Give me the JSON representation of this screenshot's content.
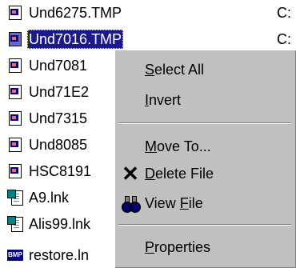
{
  "files": [
    {
      "name": "Und6275.TMP",
      "icon": "tmp-file-icon",
      "path": "C:"
    },
    {
      "name": "Und7016.TMP",
      "icon": "tmp-file-icon",
      "path": "C:",
      "selected": true
    },
    {
      "name": "Und7081",
      "icon": "tmp-file-icon",
      "path": ""
    },
    {
      "name": "Und71E2",
      "icon": "tmp-file-icon",
      "path": ""
    },
    {
      "name": "Und7315",
      "icon": "tmp-file-icon",
      "path": ""
    },
    {
      "name": "Und8085",
      "icon": "tmp-file-icon",
      "path": ""
    },
    {
      "name": "HSC8191",
      "icon": "tmp-file-icon",
      "path": ""
    },
    {
      "name": "A9.lnk",
      "icon": "shortcut-file-icon",
      "path": ""
    },
    {
      "name": "Alis99.lnk",
      "icon": "shortcut-file-icon",
      "path": ""
    },
    {
      "name": "restore.ln",
      "icon": "bmp-file-icon",
      "path": ""
    }
  ],
  "bmp_badge": "BMP",
  "menu": {
    "select_all": {
      "pre": "",
      "key": "S",
      "post": "elect All"
    },
    "invert": {
      "pre": "",
      "key": "I",
      "post": "nvert"
    },
    "move_to": {
      "pre": "",
      "key": "M",
      "post": "ove To..."
    },
    "delete_file": {
      "pre": "",
      "key": "D",
      "post": "elete File"
    },
    "view_file": {
      "pre": "View ",
      "key": "F",
      "post": "ile"
    },
    "properties": {
      "pre": "",
      "key": "P",
      "post": "roperties"
    }
  },
  "colors": {
    "selection": "#1a1a8c",
    "menu_face": "#c0c0c0"
  }
}
